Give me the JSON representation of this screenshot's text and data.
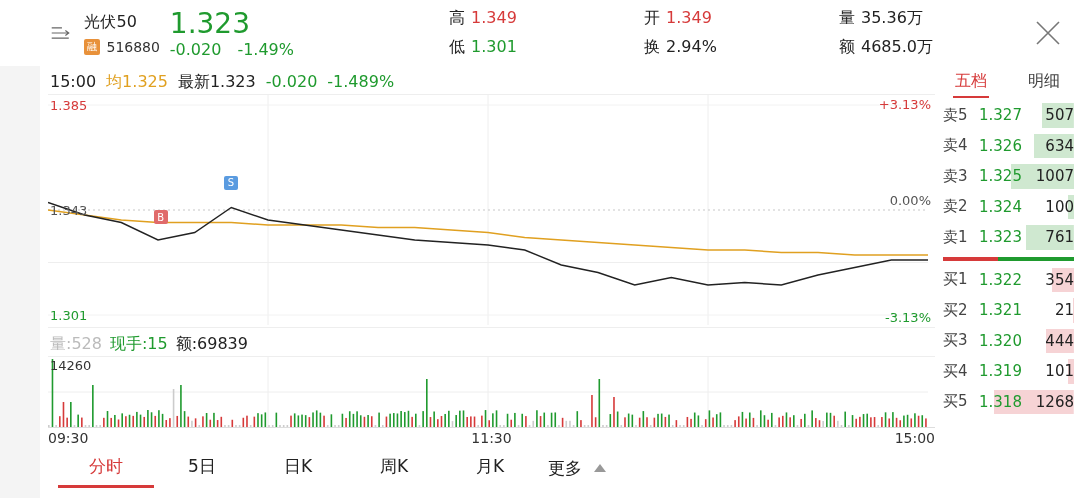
{
  "header": {
    "name": "光伏50",
    "badge": "融",
    "code": "516880",
    "price": "1.323",
    "change": "-0.020",
    "change_pct": "-1.49%",
    "stats": [
      {
        "label": "高",
        "value": "1.349",
        "color": "#d63a3a"
      },
      {
        "label": "低",
        "value": "1.301",
        "color": "#1f9a2e"
      },
      {
        "label": "开",
        "value": "1.349",
        "color": "#d63a3a"
      },
      {
        "label": "换",
        "value": "2.94%",
        "color": "#222222"
      },
      {
        "label": "量",
        "value": "35.36万",
        "color": "#222222"
      },
      {
        "label": "额",
        "value": "4685.0万",
        "color": "#222222"
      }
    ]
  },
  "chart": {
    "time": "15:00",
    "average": "均1.325",
    "latest": "最新1.323",
    "change": "-0.020",
    "change_pct": "-1.489%",
    "pct_high": "+3.13%",
    "pct_mid": "0.00%",
    "pct_low": "-3.13%",
    "markers": [
      {
        "label": "B",
        "kind": "buy"
      },
      {
        "label": "S",
        "kind": "sell"
      }
    ],
    "chart_data": {
      "type": "line",
      "grid": true,
      "ylim": [
        1.301,
        1.385
      ],
      "yticks": [
        {
          "value": 1.385,
          "label": "1.385"
        },
        {
          "value": 1.343,
          "label": "1.343"
        },
        {
          "value": 1.301,
          "label": "1.301"
        }
      ],
      "series": [
        {
          "color": "#c8c8c8",
          "line_style": "dashed",
          "values": [
            1.343,
            1.343,
            1.343,
            1.343,
            1.343,
            1.343,
            1.343,
            1.343,
            1.343,
            1.343,
            1.343,
            1.343,
            1.343,
            1.343,
            1.343,
            1.343,
            1.343,
            1.343,
            1.343,
            1.343,
            1.343,
            1.343,
            1.343,
            1.343,
            1.343
          ]
        },
        {
          "color": "#222222",
          "values": [
            1.346,
            1.341,
            1.338,
            1.331,
            1.334,
            1.344,
            1.339,
            1.337,
            1.335,
            1.333,
            1.331,
            1.33,
            1.329,
            1.327,
            1.321,
            1.318,
            1.313,
            1.316,
            1.313,
            1.314,
            1.313,
            1.317,
            1.32,
            1.323,
            1.323
          ]
        },
        {
          "color": "#e0a020",
          "values": [
            1.343,
            1.341,
            1.339,
            1.338,
            1.338,
            1.338,
            1.337,
            1.337,
            1.337,
            1.336,
            1.336,
            1.335,
            1.334,
            1.332,
            1.331,
            1.33,
            1.329,
            1.328,
            1.327,
            1.327,
            1.326,
            1.326,
            1.325,
            1.325,
            1.325
          ]
        }
      ]
    }
  },
  "volume": {
    "volume_label": "量:528",
    "hand": "现手:15",
    "amount": "额:69839",
    "max": "14260",
    "times": [
      "09:30",
      "11:30",
      "15:00"
    ]
  },
  "order_book": {
    "tabs": [
      {
        "label": "五档",
        "selected": true
      },
      {
        "label": "明细",
        "selected": false
      }
    ],
    "asks": [
      {
        "label": "卖5",
        "price": "1.327",
        "volume": "507"
      },
      {
        "label": "卖4",
        "price": "1.326",
        "volume": "634"
      },
      {
        "label": "卖3",
        "price": "1.325",
        "volume": "1007"
      },
      {
        "label": "卖2",
        "price": "1.324",
        "volume": "100"
      },
      {
        "label": "卖1",
        "price": "1.323",
        "volume": "761"
      }
    ],
    "bids": [
      {
        "label": "买1",
        "price": "1.322",
        "volume": "354"
      },
      {
        "label": "买2",
        "price": "1.321",
        "volume": "21"
      },
      {
        "label": "买3",
        "price": "1.320",
        "volume": "444"
      },
      {
        "label": "买4",
        "price": "1.319",
        "volume": "101"
      },
      {
        "label": "买5",
        "price": "1.318",
        "volume": "1268"
      }
    ]
  },
  "tabs": [
    {
      "label": "分时",
      "selected": true
    },
    {
      "label": "5日",
      "selected": false
    },
    {
      "label": "日K",
      "selected": false
    },
    {
      "label": "周K",
      "selected": false
    },
    {
      "label": "月K",
      "selected": false
    }
  ],
  "more": "更多"
}
